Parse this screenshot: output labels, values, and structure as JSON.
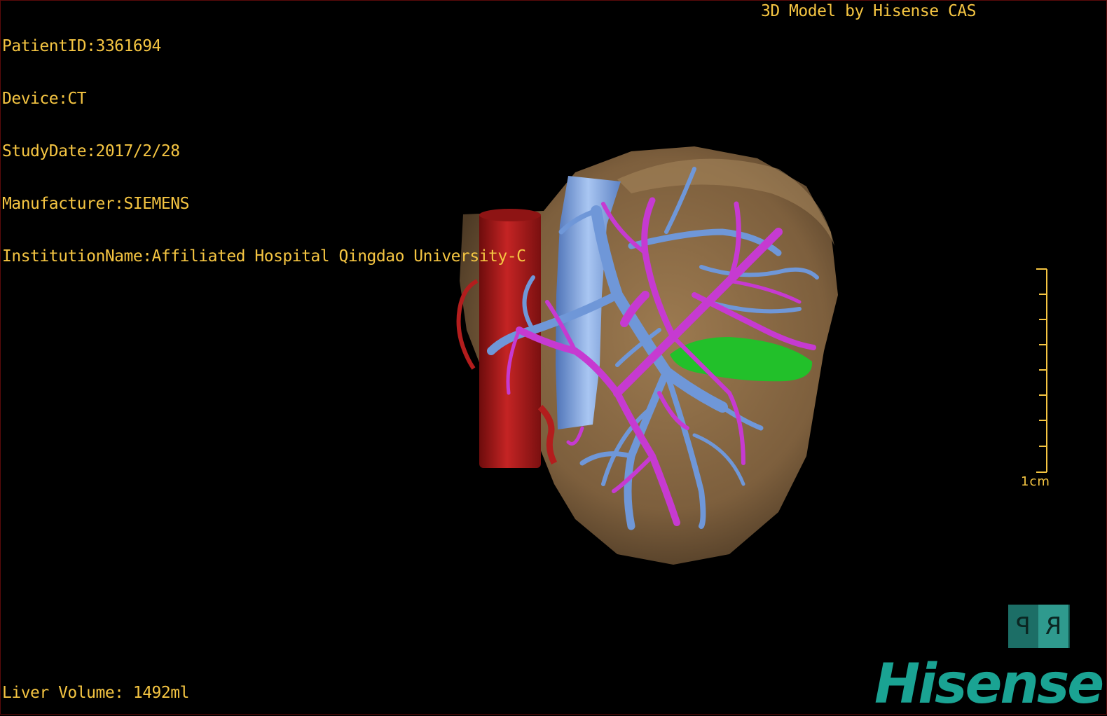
{
  "study": {
    "patient_id": "PatientID:3361694",
    "device": "Device:CT",
    "study_date": "StudyDate:2017/2/28",
    "manufacturer": "Manufacturer:SIEMENS",
    "institution": "InstitutionName:Affiliated Hospital Qingdao University-C"
  },
  "credit": "3D Model by Hisense CAS",
  "measurement": {
    "liver_volume": "Liver Volume: 1492ml"
  },
  "scale_bar": {
    "label": "1cm"
  },
  "orientation_cube": {
    "face_left": "P",
    "face_right": "R"
  },
  "brand": {
    "logo_text": "Hisense"
  },
  "colors": {
    "overlay_text": "#f5c542",
    "liver": "#8a6a45",
    "aorta": "#b31d1d",
    "vena_cava": "#7fa8e6",
    "portal_vein": "#c63ad1",
    "hepatic_vein": "#6f97d8",
    "gallbladder": "#22c02a",
    "brand": "#1aa393",
    "cube_dark": "#1c6e66",
    "cube_light": "#2f9a8e"
  }
}
